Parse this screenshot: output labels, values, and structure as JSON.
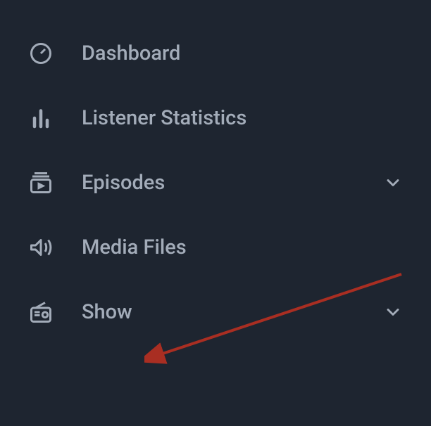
{
  "sidebar": {
    "items": [
      {
        "label": "Dashboard",
        "icon": "dashboard-icon",
        "expandable": false
      },
      {
        "label": "Listener Statistics",
        "icon": "stats-icon",
        "expandable": false
      },
      {
        "label": "Episodes",
        "icon": "episodes-icon",
        "expandable": true
      },
      {
        "label": "Media Files",
        "icon": "sound-icon",
        "expandable": false
      },
      {
        "label": "Show",
        "icon": "radio-icon",
        "expandable": true
      }
    ]
  },
  "annotation": {
    "type": "arrow",
    "color": "#a92e22",
    "target": "show-item"
  }
}
